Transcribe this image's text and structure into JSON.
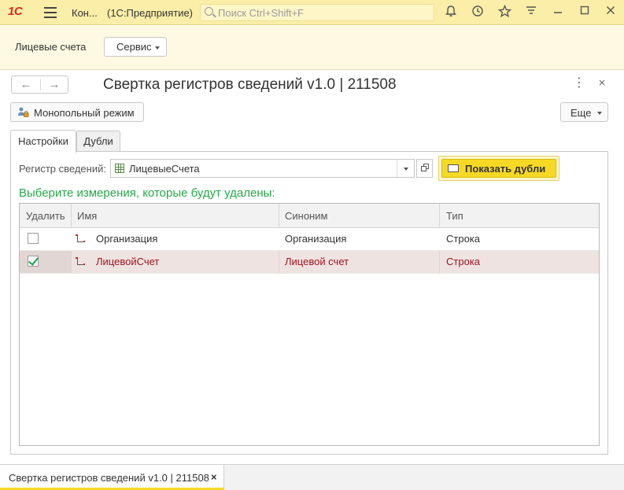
{
  "titlebar": {
    "logo": "1С",
    "app_short": "Кон...",
    "app_name": "(1С:Предприятие)",
    "search_placeholder": "Поиск Ctrl+Shift+F",
    "icons": [
      "burger-menu-icon",
      "bell-icon",
      "history-icon",
      "star-icon",
      "filter-icon",
      "minimize-icon",
      "maximize-icon",
      "close-icon"
    ]
  },
  "section": {
    "link": "Лицевые счета",
    "service_label": "Сервис"
  },
  "form": {
    "title": "Свертка регистров сведений v1.0 | 211508",
    "mono_label": "Монопольный режим",
    "more_label": "Еще",
    "tabs": [
      {
        "label": "Настройки",
        "active": true
      },
      {
        "label": "Дубли",
        "active": false
      }
    ],
    "register_label": "Регистр сведений:",
    "register_value": "ЛицевыеСчета",
    "show_dupes_label": "Показать дубли",
    "hint": "Выберите измерения, которые будут удалены:",
    "table": {
      "headers": [
        "Удалить",
        "Имя",
        "Синоним",
        "Тип"
      ],
      "rows": [
        {
          "delete": false,
          "name": "Организация",
          "synonym": "Организация",
          "type": "Строка",
          "selected": false
        },
        {
          "delete": true,
          "name": "ЛицевойСчет",
          "synonym": "Лицевой счет",
          "type": "Строка",
          "selected": true
        }
      ]
    }
  },
  "bottom": {
    "open_tab": "Свертка регистров сведений v1.0 | 211508",
    "close_glyph": "×"
  },
  "colors": {
    "titlebar_bg": "#fbeea9",
    "accent_yellow": "#f7d925",
    "hint_green": "#27a84a",
    "selected_row_text": "#a1131e",
    "logo_red": "#d92a1c"
  }
}
